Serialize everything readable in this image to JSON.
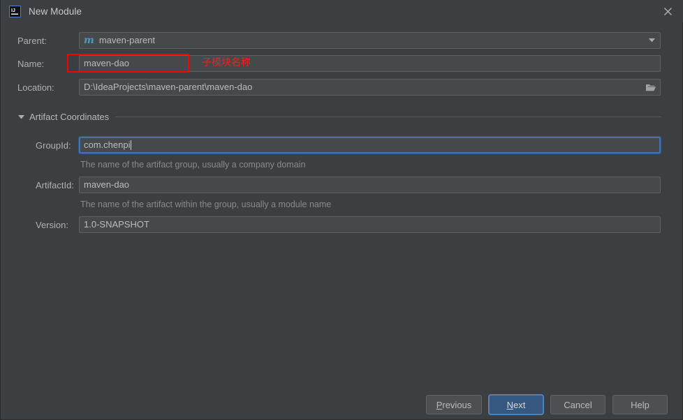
{
  "window": {
    "title": "New Module",
    "app_icon": "intellij-idea-icon",
    "close_icon": "close-icon"
  },
  "form": {
    "parent": {
      "label": "Parent:",
      "value": "maven-parent",
      "icon": "maven-module-icon",
      "dropdown_icon": "chevron-down-icon"
    },
    "name": {
      "label": "Name:",
      "value": "maven-dao"
    },
    "location": {
      "label": "Location:",
      "value": "D:\\IdeaProjects\\maven-parent\\maven-dao",
      "browse_icon": "folder-icon"
    }
  },
  "annotation": {
    "text": "子模块名称",
    "color": "#ff1a1a"
  },
  "section": {
    "title": "Artifact Coordinates",
    "collapse_icon": "triangle-down-icon",
    "fields": {
      "group_id": {
        "label": "GroupId:",
        "value": "com.chenpi",
        "hint": "The name of the artifact group, usually a company domain",
        "focused": true
      },
      "artifact_id": {
        "label": "ArtifactId:",
        "value": "maven-dao",
        "hint": "The name of the artifact within the group, usually a module name"
      },
      "version": {
        "label": "Version:",
        "value": "1.0-SNAPSHOT"
      }
    }
  },
  "buttons": {
    "previous": {
      "label_pre": "P",
      "label_post": "revious"
    },
    "next": {
      "label_pre": "N",
      "label_post": "ext"
    },
    "cancel": {
      "label": "Cancel"
    },
    "help": {
      "label": "Help"
    }
  },
  "colors": {
    "background": "#3c3f41",
    "field_background": "#45494a",
    "accent": "#365880",
    "focus_border": "#4b6eaf",
    "annotation_red": "#ff0000",
    "maven_icon": "#4b9ac6"
  }
}
